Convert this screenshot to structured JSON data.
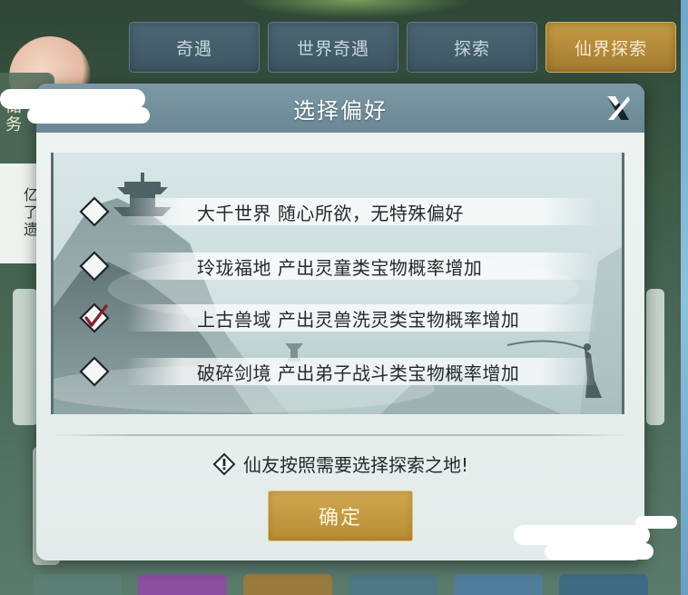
{
  "tabs": [
    {
      "label": "奇遇",
      "active": false
    },
    {
      "label": "世界奇遇",
      "active": false
    },
    {
      "label": "探索",
      "active": false
    },
    {
      "label": "仙界探索",
      "active": true
    }
  ],
  "background": {
    "left_panel_text": "储\n务",
    "side_text": "亿\n了\n遗"
  },
  "dialog": {
    "title": "选择偏好",
    "options": [
      {
        "label": "大千世界 随心所欲，无特殊偏好",
        "checked": false
      },
      {
        "label": "玲珑福地 产出灵童类宝物概率增加",
        "checked": false
      },
      {
        "label": "上古兽域 产出灵兽洗灵类宝物概率增加",
        "checked": true
      },
      {
        "label": "破碎剑境 产出弟子战斗类宝物概率增加",
        "checked": false
      }
    ],
    "hint": "仙友按照需要选择探索之地!",
    "confirm_label": "确定"
  },
  "colors": {
    "tab_active": "#b88c3a",
    "tab_inactive": "#445c6a",
    "header": "#7590a0",
    "confirm": "#c49b43",
    "check_mark": "#8b1e2b"
  },
  "icons": {
    "close": "close-x-icon",
    "hint": "warning-diamond-icon",
    "check": "checkbox-diamond-icon"
  }
}
